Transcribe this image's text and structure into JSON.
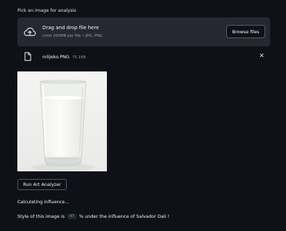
{
  "uploader": {
    "label": "Pick an image for analysis",
    "drop_title": "Drag and drop file here",
    "drop_limit": "Limit 200MB per file • JPG, PNG",
    "browse_label": "Browse files"
  },
  "file": {
    "name": "mlijeko.PNG",
    "size": "75.1KB"
  },
  "image": {
    "icon": "glass-of-milk-photo"
  },
  "actions": {
    "analyze_label": "Run Art Analyzer"
  },
  "status": {
    "calculating": "Calculating influence...",
    "result_prefix": "Style of this image is",
    "result_value": "47",
    "result_suffix": "% under the influence of Salvador Dali !"
  },
  "colors": {
    "background": "#0e1117",
    "panel": "#262730",
    "code_green": "#4fbf6a"
  }
}
